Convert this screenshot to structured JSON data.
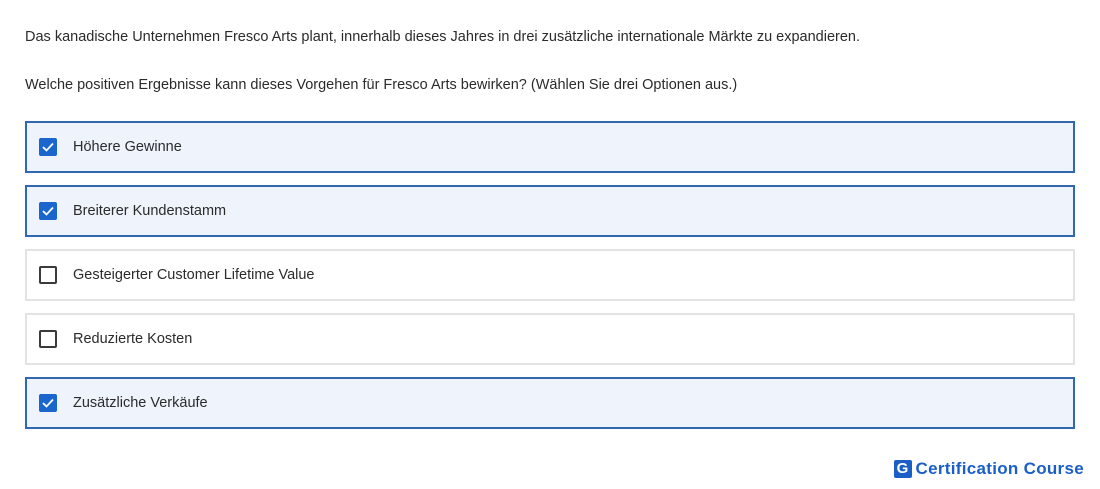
{
  "question": {
    "intro": "Das kanadische Unternehmen Fresco Arts plant, innerhalb dieses Jahres in drei zusätzliche internationale Märkte zu expandieren.",
    "prompt": "Welche positiven Ergebnisse kann dieses Vorgehen für Fresco Arts bewirken? (Wählen Sie drei Optionen aus.)"
  },
  "options": [
    {
      "label": "Höhere Gewinne",
      "checked": true
    },
    {
      "label": "Breiterer Kundenstamm",
      "checked": true
    },
    {
      "label": "Gesteigerter Customer Lifetime Value",
      "checked": false
    },
    {
      "label": "Reduzierte Kosten",
      "checked": false
    },
    {
      "label": "Zusätzliche Verkäufe",
      "checked": true
    }
  ],
  "brand": {
    "mark": "G",
    "text": "Certification Course"
  },
  "colors": {
    "accent": "#1a66cc",
    "selected_border": "#2f67b3",
    "selected_background": "#eef3fc",
    "brand": "#1a5fc8"
  }
}
